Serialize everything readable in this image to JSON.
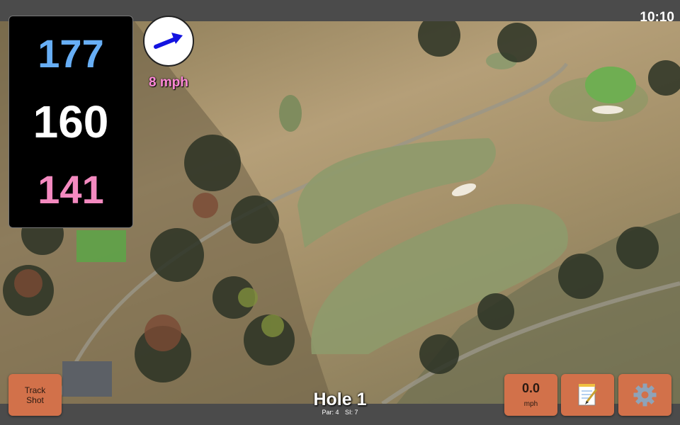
{
  "status_bar": {
    "time": "10:10"
  },
  "distances": {
    "back": "177",
    "middle": "160",
    "front": "141"
  },
  "wind": {
    "speed_label": "8 mph"
  },
  "buttons": {
    "track_shot": "Track\nShot",
    "speed_value": "0.0",
    "speed_unit": "mph"
  },
  "hole": {
    "title": "Hole 1",
    "par": "Par: 4",
    "si": "SI: 7"
  },
  "icons": {
    "notes": "notepad-icon",
    "settings": "gear-icon",
    "wind": "wind-arrow-icon"
  },
  "colors": {
    "back": "#67aef5",
    "middle": "#ffffff",
    "front": "#f48ac0",
    "button": "#d2714a",
    "wind_label": "#ff88d8"
  }
}
